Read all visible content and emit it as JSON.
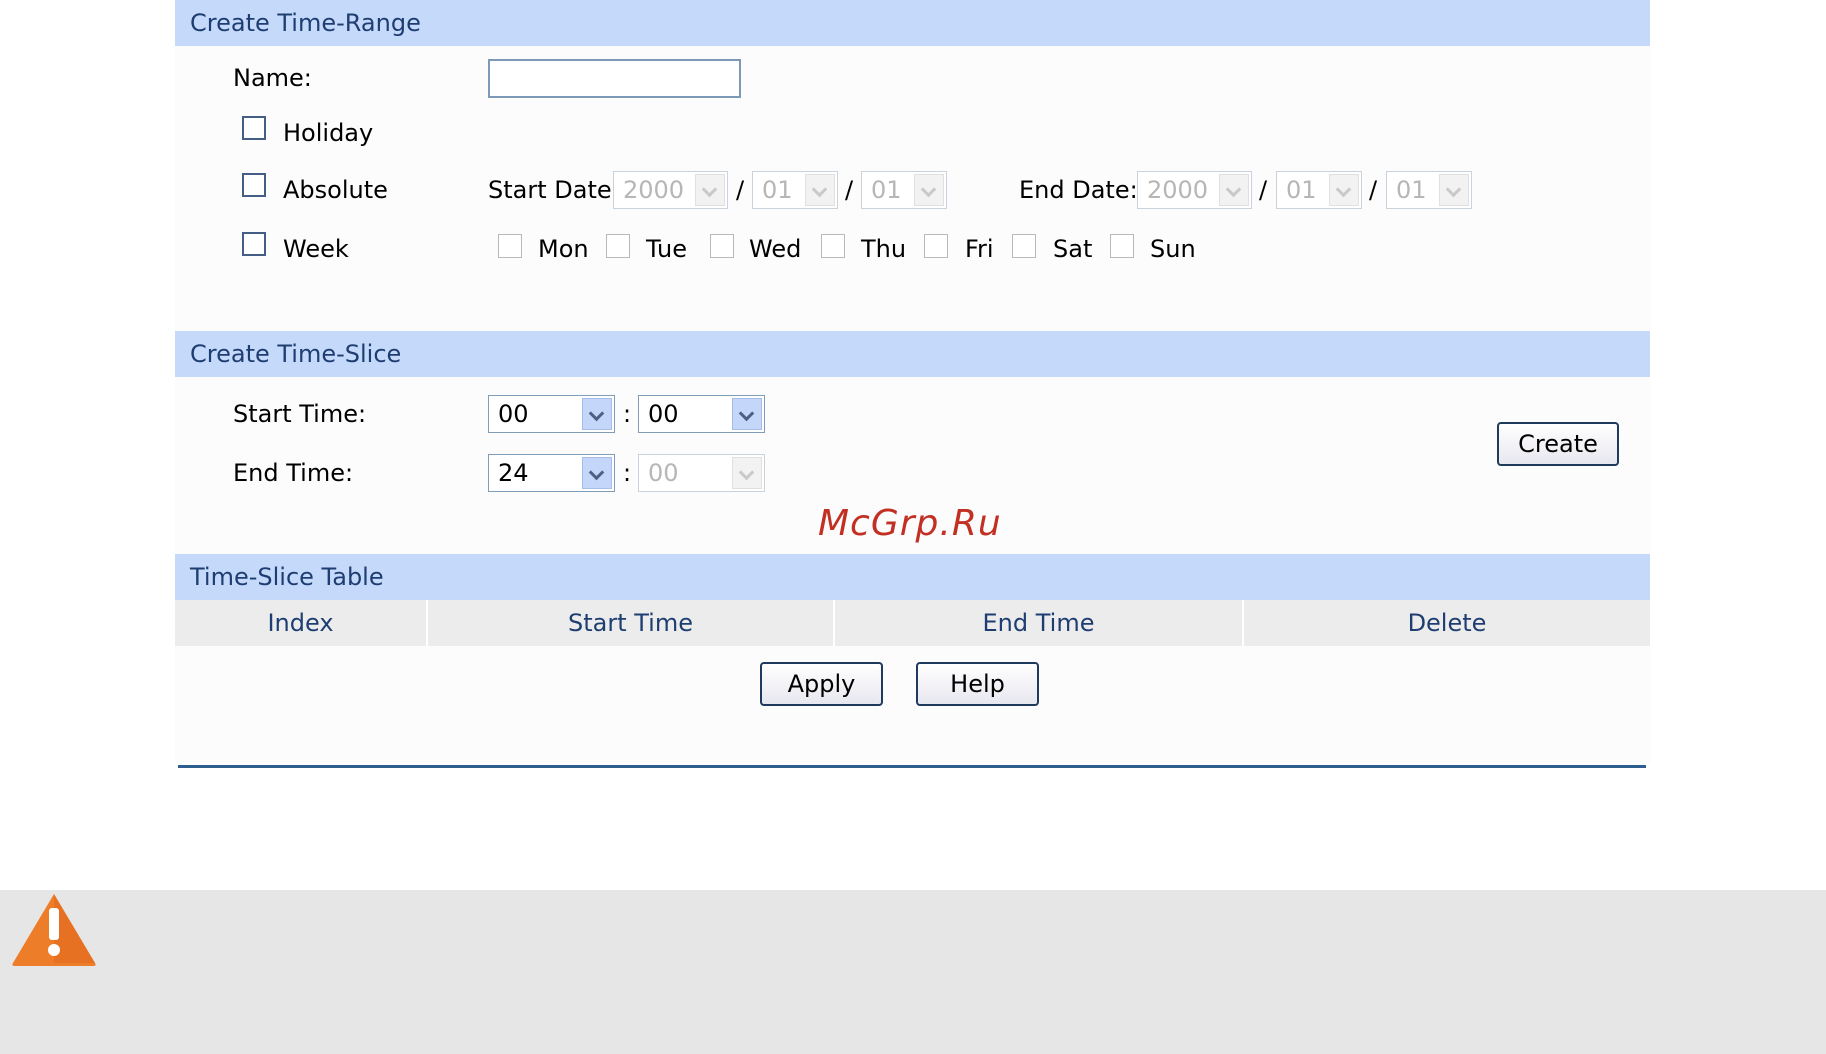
{
  "range": {
    "header": "Create Time-Range",
    "name_label": "Name:",
    "name_value": "",
    "holiday_label": "Holiday",
    "absolute_label": "Absolute",
    "week_label": "Week",
    "start_date_label": "Start Date:",
    "end_date_label": "End Date:",
    "start_year": "2000",
    "start_month": "01",
    "start_day": "01",
    "end_year": "2000",
    "end_month": "01",
    "end_day": "01",
    "date_sep": "/",
    "days": [
      "Mon",
      "Tue",
      "Wed",
      "Thu",
      "Fri",
      "Sat",
      "Sun"
    ]
  },
  "slice": {
    "header": "Create Time-Slice",
    "start_label": "Start Time:",
    "end_label": "End Time:",
    "start_hour": "00",
    "start_minute": "00",
    "end_hour": "24",
    "end_minute": "00",
    "time_sep": ":",
    "create_button": "Create"
  },
  "watermark": "McGrp.Ru",
  "table": {
    "header": "Time-Slice Table",
    "columns": [
      "Index",
      "Start Time",
      "End Time",
      "Delete"
    ]
  },
  "buttons": {
    "apply": "Apply",
    "help": "Help"
  },
  "colors": {
    "section_header": "#c5d9fb",
    "header_text": "#1e3e72",
    "warning": "#ee7d2a"
  },
  "icons": {
    "warning": "warning-triangle-icon"
  }
}
